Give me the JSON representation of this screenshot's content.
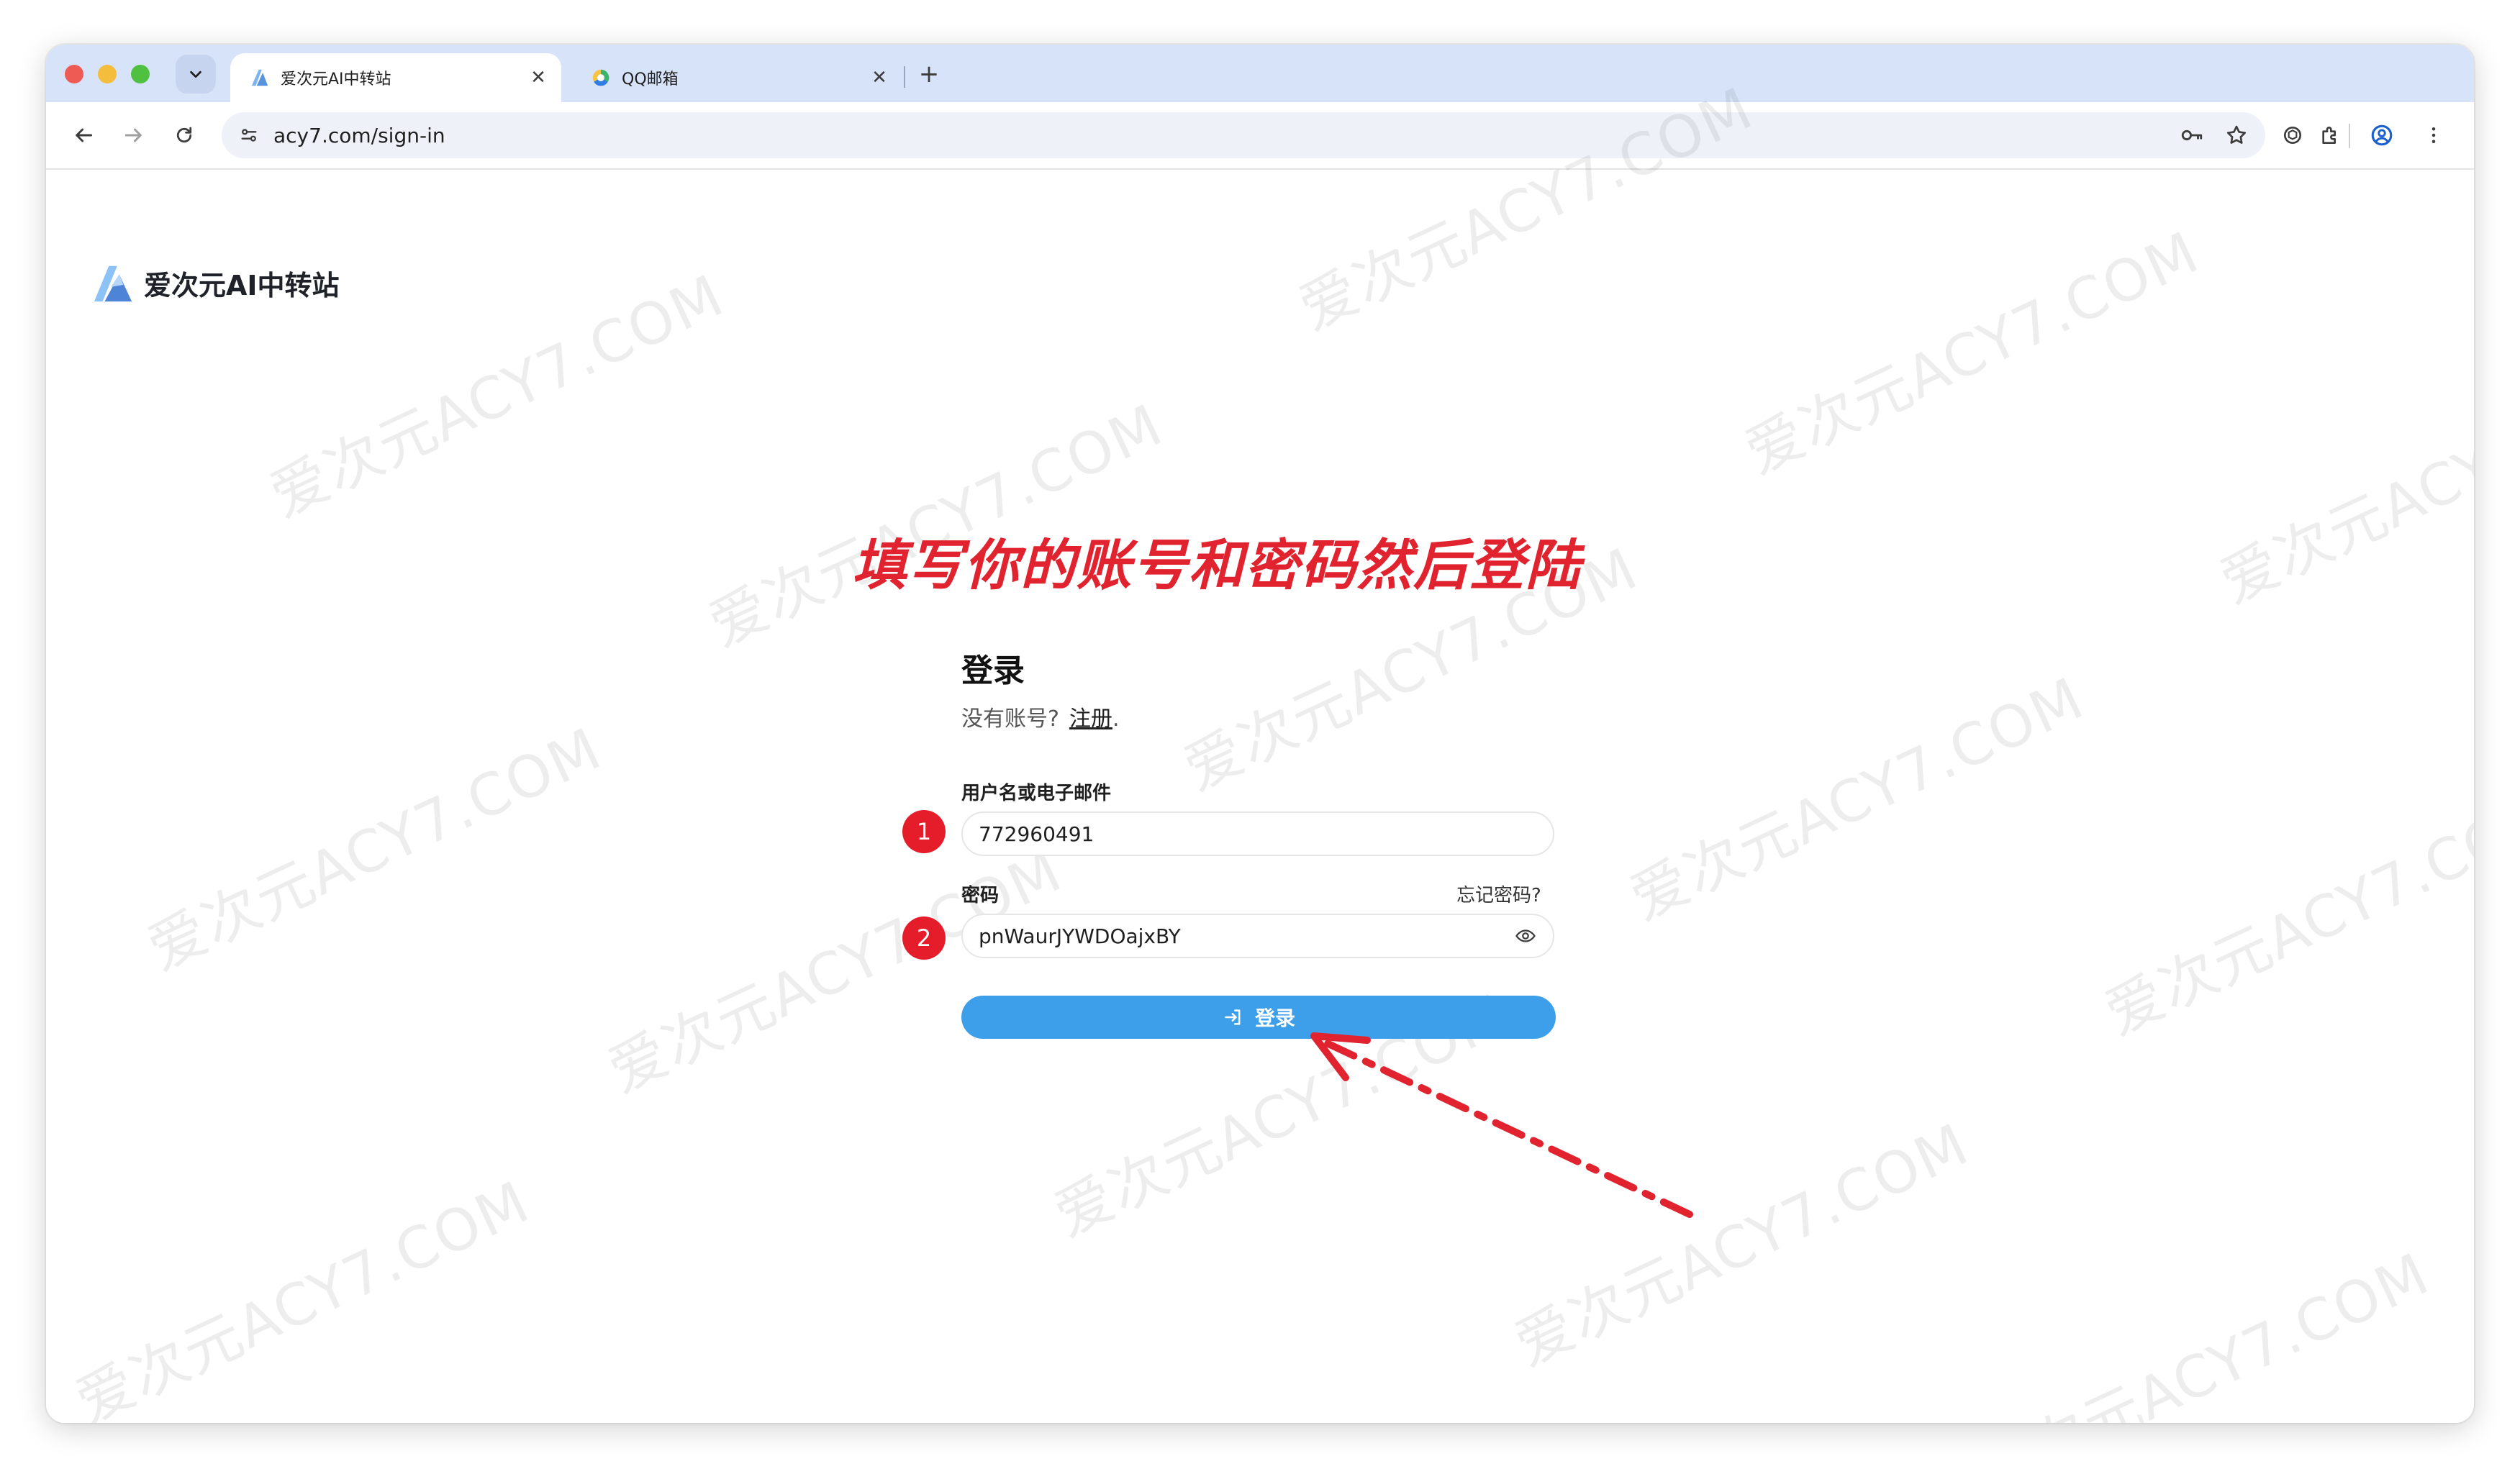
{
  "browser": {
    "tabs": [
      {
        "label": "爱次元AI中转站",
        "active": true
      },
      {
        "label": "QQ邮箱",
        "active": false
      }
    ],
    "url": "acy7.com/sign-in"
  },
  "site": {
    "brand_name": "爱次元AI中转站",
    "watermark_text": "爱次元ACY7.COM"
  },
  "annotation": {
    "instruction": "填写你的账号和密码然后登陆",
    "color": "#e0232e",
    "step1": "1",
    "step2": "2"
  },
  "login": {
    "title": "登录",
    "no_account": "没有账号?",
    "register_link": "注册",
    "register_suffix": ".",
    "username_label": "用户名或电子邮件",
    "username_value": "772960491",
    "password_label": "密码",
    "forgot_password": "忘记密码?",
    "password_value": "pnWaurJYWDOajxBY",
    "submit_label": "登录",
    "submit_color": "#3d9ee9"
  }
}
